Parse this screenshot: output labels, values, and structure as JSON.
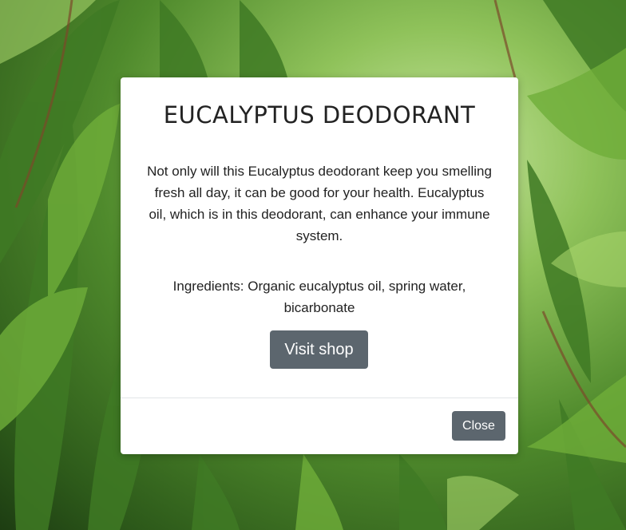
{
  "modal": {
    "title": "EUCALYPTUS DEODORANT",
    "description": "Not only will this Eucalyptus deodorant keep you smelling fresh all day, it can be good for your health. Eucalyptus oil, which is in this deodorant, can enhance your immune system.",
    "ingredients": "Ingredients: Organic eucalyptus oil, spring water, bicarbonate",
    "visit_shop_label": "Visit shop",
    "close_label": "Close"
  },
  "background": {
    "subject": "eucalyptus-leaves-photo"
  },
  "colors": {
    "button_bg": "#5c666e",
    "button_text": "#ffffff",
    "modal_bg": "#ffffff",
    "text": "#222222",
    "leaf_green": "#4f8a2c"
  }
}
